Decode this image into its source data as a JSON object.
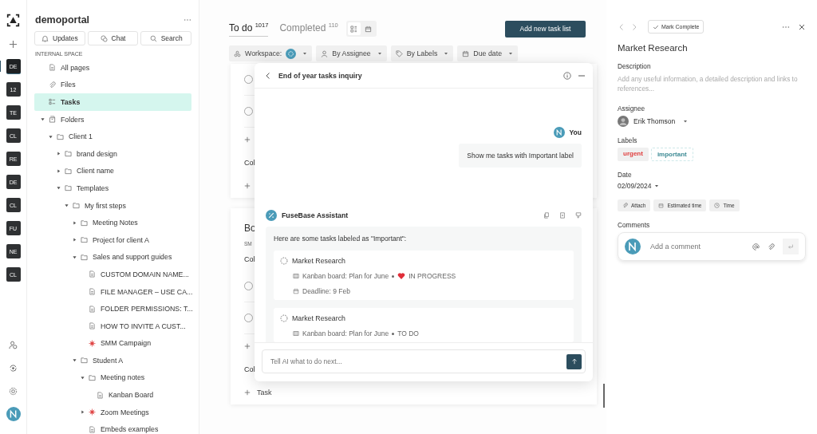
{
  "rail": {
    "badges": [
      {
        "label": "DE",
        "selected": true
      },
      {
        "label": "12",
        "selected": false
      },
      {
        "label": "TE",
        "selected": false
      },
      {
        "label": "CL",
        "selected": false
      },
      {
        "label": "RE",
        "selected": false
      },
      {
        "label": "DE",
        "selected": false
      },
      {
        "label": "CL",
        "selected": false
      },
      {
        "label": "FU",
        "selected": false
      },
      {
        "label": "NE",
        "selected": false
      },
      {
        "label": "CL",
        "selected": false
      }
    ]
  },
  "sidebar": {
    "title": "demoportal",
    "buttons": [
      {
        "kind": "bell",
        "label": "Updates"
      },
      {
        "kind": "chat",
        "label": "Chat"
      },
      {
        "kind": "search",
        "label": "Search"
      }
    ],
    "section": "INTERNAL SPACE",
    "tree": [
      {
        "kind": "page",
        "label": "All pages",
        "selected": false
      },
      {
        "kind": "files",
        "label": "Files",
        "selected": false
      },
      {
        "kind": "tasks",
        "label": "Tasks",
        "selected": true
      },
      {
        "kind": "workspace",
        "label": "Folders",
        "selected": false,
        "expanded": true,
        "children": [
          {
            "kind": "folder",
            "label": "Client 1",
            "selected": false,
            "expanded": true,
            "children": [
              {
                "kind": "folder",
                "label": "brand design",
                "selected": false,
                "expanded": false
              },
              {
                "kind": "folder",
                "label": "Client name",
                "selected": false,
                "expanded": false
              },
              {
                "kind": "folder",
                "label": "Templates",
                "selected": false,
                "expanded": true,
                "children": [
                  {
                    "kind": "folder",
                    "label": "My first steps",
                    "selected": false,
                    "expanded": true,
                    "children": [
                      {
                        "kind": "folder",
                        "label": "Meeting Notes",
                        "selected": false,
                        "expanded": false
                      },
                      {
                        "kind": "folder",
                        "label": "Project for client A",
                        "selected": false,
                        "expanded": false
                      },
                      {
                        "kind": "folder",
                        "label": "Sales and support guides",
                        "selected": false,
                        "expanded": true,
                        "children": [
                          {
                            "kind": "doc",
                            "label": "CUSTOM DOMAIN NAME...",
                            "selected": false
                          },
                          {
                            "kind": "doc",
                            "label": "FILE MANAGER – USE CA...",
                            "selected": false
                          },
                          {
                            "kind": "doc",
                            "label": "FOLDER PERMISSIONS: T...",
                            "selected": false
                          },
                          {
                            "kind": "doc",
                            "label": "HOW TO INVITE A CUST...",
                            "selected": false
                          },
                          {
                            "kind": "campaign",
                            "label": "SMM Campaign",
                            "selected": false
                          }
                        ]
                      },
                      {
                        "kind": "folder",
                        "label": "Student A",
                        "selected": false,
                        "expanded": true,
                        "children": [
                          {
                            "kind": "folder",
                            "label": "Meeting notes",
                            "selected": false,
                            "expanded": true,
                            "children": [
                              {
                                "kind": "doc",
                                "label": "Kanban Board",
                                "selected": false
                              }
                            ]
                          },
                          {
                            "kind": "campaign",
                            "label": "Zoom Meetings",
                            "selected": false,
                            "expanded": false
                          },
                          {
                            "kind": "doc",
                            "label": "Embeds examples",
                            "selected": false
                          }
                        ]
                      }
                    ]
                  }
                ]
              }
            ]
          }
        ]
      }
    ]
  },
  "main": {
    "tabs": [
      {
        "label": "To do",
        "count": "1017",
        "selected": true
      },
      {
        "label": "Completed",
        "count": "110",
        "selected": false
      }
    ],
    "views": [
      {
        "kind": "board",
        "selected": true
      },
      {
        "kind": "calendar",
        "selected": false
      }
    ],
    "add_button": "Add new task list",
    "filters": [
      {
        "kind": "workspace",
        "label": "Workspace:"
      },
      {
        "kind": "assignee",
        "label": "By Assignee"
      },
      {
        "kind": "labels",
        "label": "By Labels"
      },
      {
        "kind": "date",
        "label": "Due date"
      }
    ],
    "lists": [
      {
        "rows": [
          {
            "kind": "circle",
            "checked": false
          },
          {
            "kind": "circle",
            "checked": false
          },
          {
            "kind": "plus"
          },
          {
            "kind": "text",
            "text": "Col"
          },
          {
            "kind": "plus"
          }
        ]
      },
      {
        "rows": [
          {
            "kind": "title",
            "text": "Bo"
          },
          {
            "kind": "subtitle",
            "text": "SM"
          },
          {
            "kind": "text",
            "text": "Col"
          },
          {
            "kind": "circle",
            "checked": false
          },
          {
            "kind": "circle",
            "checked": false
          },
          {
            "kind": "plus"
          },
          {
            "kind": "text",
            "text": "Col"
          },
          {
            "kind": "add",
            "text": "Task"
          }
        ]
      }
    ]
  },
  "chat": {
    "title": "End of year tasks inquiry",
    "user": {
      "name": "You",
      "message": "Show me tasks with Important label"
    },
    "assistant": {
      "name": "FuseBase Assistant",
      "intro": "Here are some tasks labeled as \"Important\":",
      "tasks": [
        {
          "title": "Market Research",
          "board": "Kanban board: Plan for June",
          "status": "IN PROGRESS",
          "heart": true,
          "deadline": "Deadline: 9 Feb"
        },
        {
          "title": "Market Research",
          "board": "Kanban board: Plan for June",
          "status": "TO DO",
          "heart": false
        }
      ]
    },
    "input": {
      "placeholder": "Tell AI what to do next..."
    }
  },
  "task": {
    "mark_complete": "Mark Complete",
    "title": "Market Research",
    "description": {
      "label": "Description",
      "placeholder": "Add any useful information, a detailed description and links to references..."
    },
    "assignee": {
      "label": "Assignee",
      "name": "Erik Thomson"
    },
    "labels": {
      "label": "Labels",
      "items": [
        {
          "text": "urgent",
          "color": "#e03c3c"
        },
        {
          "text": "important",
          "color": "#3d8a94"
        }
      ]
    },
    "date": {
      "label": "Date",
      "value": "02/09/2024"
    },
    "actions": [
      {
        "kind": "attach",
        "label": "Attach"
      },
      {
        "kind": "estimate",
        "label": "Estimated time"
      },
      {
        "kind": "time",
        "label": "Time"
      }
    ],
    "comments": {
      "label": "Comments",
      "placeholder": "Add a comment"
    }
  }
}
